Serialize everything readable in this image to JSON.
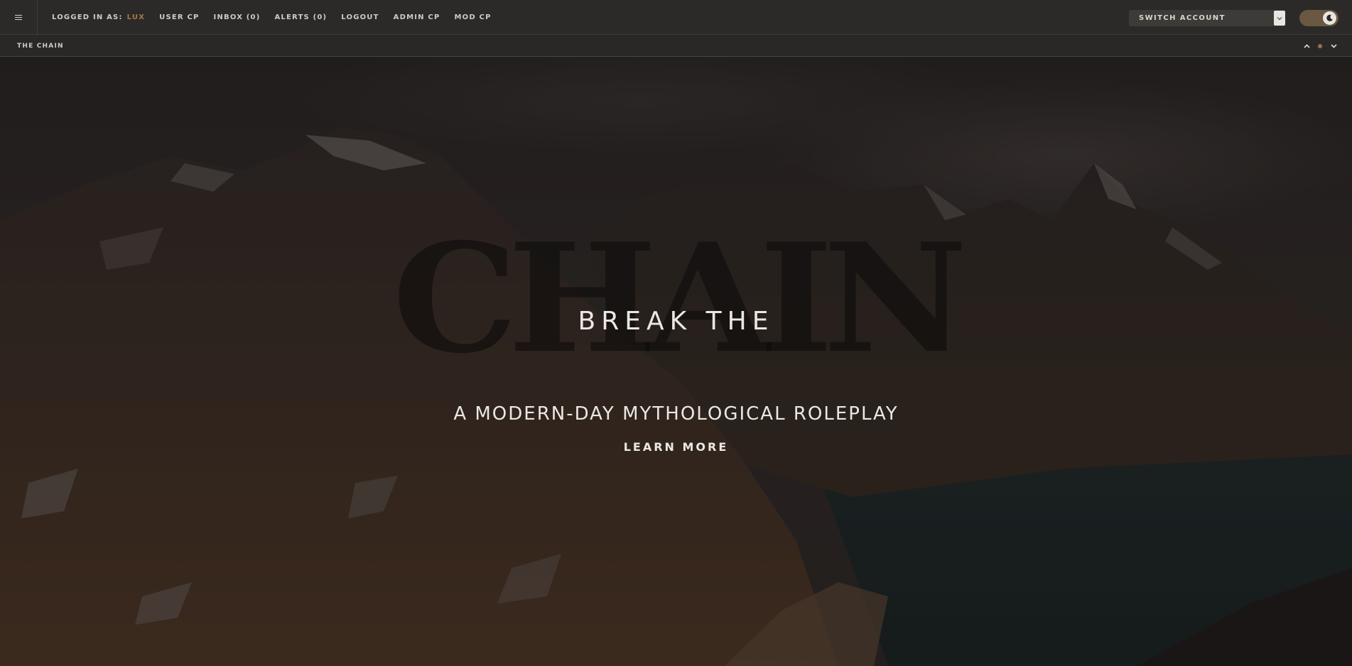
{
  "topbar": {
    "login_label": "LOGGED IN AS:",
    "username": "LUX",
    "nav": [
      "USER CP",
      "INBOX (0)",
      "ALERTS (0)",
      "LOGOUT",
      "ADMIN CP",
      "MOD CP"
    ],
    "switch_account": "SWITCH ACCOUNT"
  },
  "subbar": {
    "breadcrumb": "THE CHAIN"
  },
  "hero": {
    "ghost_word": "CHAIN",
    "headline": "BREAK THE",
    "tagline": "A MODERN-DAY MYTHOLOGICAL ROLEPLAY",
    "cta": "LEARN MORE"
  },
  "colors": {
    "accent": "#a5764a",
    "topbar": "#2c2a29",
    "toggle": "#6a5843"
  },
  "icons": [
    "menu-icon",
    "chevron-down-icon",
    "moon-icon",
    "chevron-up-icon",
    "dot-icon"
  ]
}
